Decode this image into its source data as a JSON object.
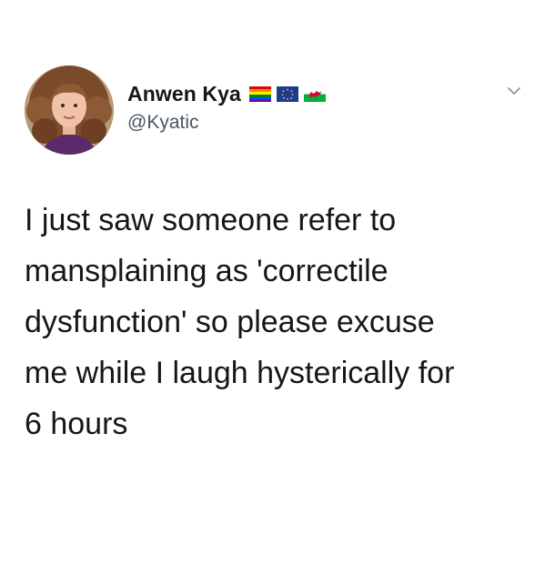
{
  "author": {
    "display_name": "Anwen Kya",
    "handle": "@Kyatic",
    "avatar": "avatar-photo",
    "flag_icons": [
      "rainbow-flag-icon",
      "eu-flag-icon",
      "wales-flag-icon"
    ]
  },
  "menu": {
    "icon": "chevron-down-icon"
  },
  "tweet": {
    "lines": [
      "I just saw someone refer to",
      "mansplaining as 'correctile",
      "dysfunction' so please excuse",
      "me while I laugh hysterically for",
      "6 hours"
    ]
  },
  "colors": {
    "text": "#14171a",
    "handle": "#4b5660",
    "background": "#ffffff",
    "chevron": "#8899a6"
  }
}
